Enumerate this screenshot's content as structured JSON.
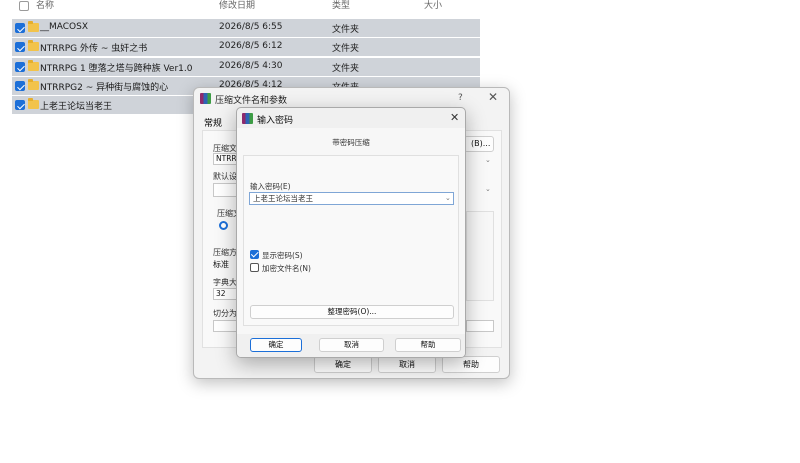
{
  "explorer": {
    "columns": {
      "name": "名称",
      "modified": "修改日期",
      "type": "类型",
      "size": "大小"
    },
    "rows": [
      {
        "name": "__MACOSX",
        "date": "2026/8/5 6:55",
        "type": "文件夹"
      },
      {
        "name": "NTRRPG 外传 ~ 虫奸之书",
        "date": "2026/8/5 6:12",
        "type": "文件夹"
      },
      {
        "name": "NTRRPG 1 堕落之塔与跨种族 Ver1.0",
        "date": "2026/8/5 4:30",
        "type": "文件夹"
      },
      {
        "name": "NTRRPG2 ~ 异种街与腐蚀的心",
        "date": "2026/8/5 4:12",
        "type": "文件夹"
      },
      {
        "name": "上老王论坛当老王",
        "date": "",
        "type": ""
      }
    ]
  },
  "archive_dialog": {
    "title": "压缩文件名和参数",
    "help_glyph": "?",
    "tab_general": "常规",
    "archive_name_label": "压缩文",
    "archive_name_value": "NTRRP",
    "browse_button": "(B)...",
    "default_settings_label": "默认设",
    "format_label": "压缩文",
    "method_label": "压缩方",
    "method_value": "标准",
    "dict_label": "字典大",
    "dict_value": "32",
    "split_label": "切分为",
    "ok": "确定",
    "cancel": "取消",
    "help": "帮助"
  },
  "password_dialog": {
    "title": "输入密码",
    "subtitle": "带密码压缩",
    "enter_password_label": "输入密码(E)",
    "password_value": "上老王论坛当老王",
    "show_password_label": "显示密码(S)",
    "show_password_checked": true,
    "encrypt_names_label": "加密文件名(N)",
    "encrypt_names_checked": false,
    "organize_button": "整理密码(O)...",
    "ok": "确定",
    "cancel": "取消",
    "help": "帮助"
  }
}
